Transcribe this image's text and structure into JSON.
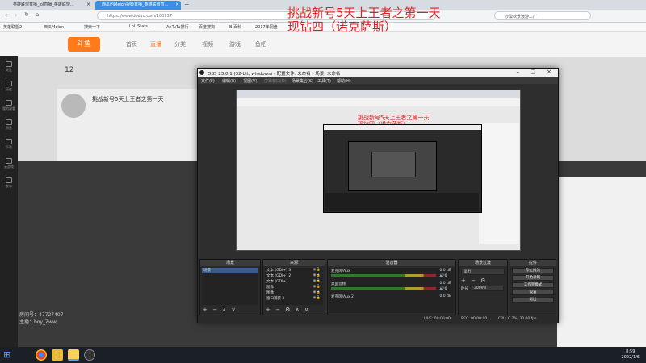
{
  "browser": {
    "tabs": [
      {
        "label": "英雄联盟直播_lol直播_英雄联盟...",
        "active": false
      },
      {
        "label": "西瓜的Melon视频直播_英雄联盟直...",
        "active": true
      }
    ],
    "url": "https://www.douyu.com/100937",
    "search_placeholder": "沙漠秋景渡游工厂",
    "bookmarks": [
      "英雄联盟2",
      "西瓜Melon",
      "搜索一下",
      "LoL Stats...",
      "AnTuTu排行",
      "百度搜狗",
      "B 百科",
      "2017年网盘"
    ]
  },
  "site": {
    "logo": "斗鱼",
    "nav": [
      "首页",
      "直播",
      "分类",
      "视频",
      "游戏",
      "鱼吧"
    ],
    "left_sidebar": [
      "关注",
      "历史",
      "我的观看",
      "消息",
      "下载",
      "云游戏",
      "发布"
    ],
    "stream_title": "挑战新号5天上王者之第一天",
    "follow_count": "12",
    "room_id_label": "房间号：47727407",
    "owner_label": "主播：boy_Zww"
  },
  "overlay": {
    "title_line1": "挑战新号5天上王者之第一天",
    "title_line2": "现钻四（诺克萨斯）"
  },
  "obs": {
    "window_title": "OBS 23.0.1 (32-bit, windows) - 配置文件: 未命名 - 场景: 未命名",
    "menu": [
      "文件(F)",
      "编辑(E)",
      "视图(V)",
      "停靠窗口(D)",
      "场景集合(S)",
      "工具(T)",
      "帮助(H)"
    ],
    "preview_title_line1": "挑战新号5天上王者之第一天",
    "preview_title_line2": "现钻四（诺克萨斯）",
    "docks": {
      "scenes": {
        "header": "场景",
        "items": [
          "场景"
        ]
      },
      "sources": {
        "header": "来源",
        "items": [
          "文本 (GDI+) 3",
          "文本 (GDI+) 2",
          "文本 (GDI+)",
          "图像",
          "图像",
          "窗口捕获 3"
        ]
      },
      "mixer": {
        "header": "混音器",
        "channels": [
          {
            "name": "麦克风/Aux",
            "db": "0.0 dB"
          },
          {
            "name": "桌面音频",
            "db": "0.0 dB"
          },
          {
            "name": "麦克风/Aux 2",
            "db": "0.0 dB"
          }
        ]
      },
      "transitions": {
        "header": "场景过渡",
        "mode": "淡出",
        "duration_label": "时长",
        "duration": "300ms"
      },
      "controls": {
        "header": "控件",
        "buttons": [
          "停止推流",
          "开始录制",
          "工作室模式",
          "设置",
          "退出"
        ]
      }
    },
    "status": {
      "live": "LIVE: 00:00:00",
      "rec": "REC: 00:00:00",
      "cpu": "CPU: 0.7%, 30.00 fps"
    }
  },
  "taskbar": {
    "time": "8:59",
    "date": "2022/1/6"
  },
  "colors": {
    "accent": "#3a8ee6",
    "overlay_red": "#e02020",
    "obs_bg": "#2e2e2e"
  }
}
